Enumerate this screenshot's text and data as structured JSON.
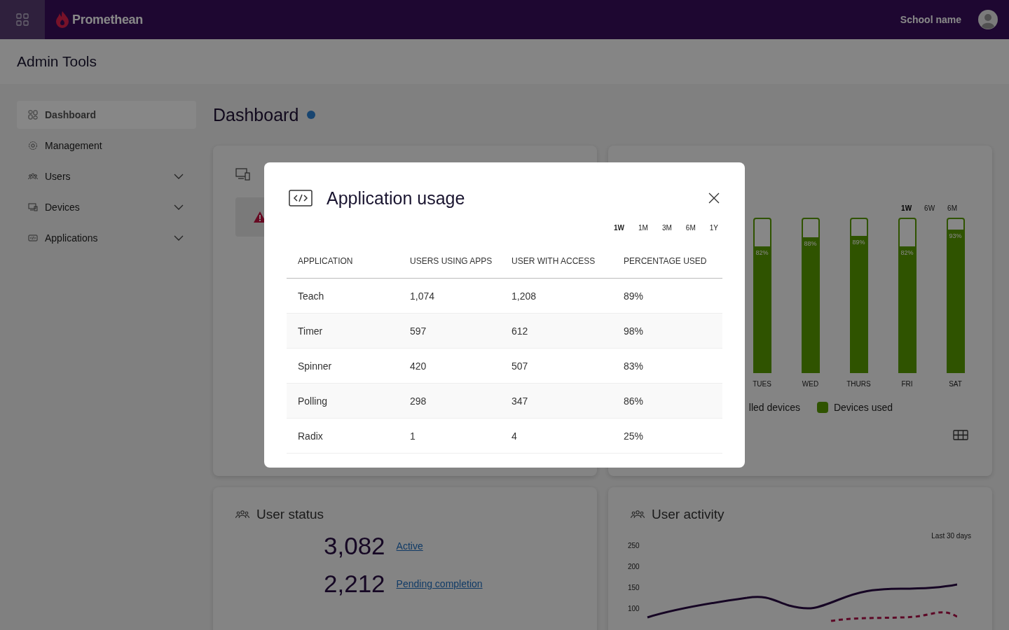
{
  "top_bar": {
    "brand": "Promethean",
    "school_name": "School name"
  },
  "header": {
    "title": "Admin Tools"
  },
  "sidebar": {
    "items": [
      {
        "label": "Dashboard",
        "selected": true
      },
      {
        "label": "Management",
        "selected": false
      },
      {
        "label": "Users",
        "selected": false,
        "expanded": false
      },
      {
        "label": "Devices",
        "selected": false,
        "expanded": false
      },
      {
        "label": "Applications",
        "selected": false,
        "expanded": false
      }
    ]
  },
  "page": {
    "title": "Dashboard"
  },
  "device_usage_card": {
    "tabs": [
      {
        "label": "1W",
        "selected": true
      },
      {
        "label": "6W",
        "selected": false
      },
      {
        "label": "6M",
        "selected": false
      }
    ],
    "bars": [
      {
        "day": "TUES",
        "label": "82%",
        "level": 0.82
      },
      {
        "day": "WED",
        "label": "88%",
        "level": 0.88
      },
      {
        "day": "THURS",
        "label": "89%",
        "level": 0.89
      },
      {
        "day": "FRI",
        "label": "82%",
        "level": 0.82
      },
      {
        "day": "SAT",
        "label": "93%",
        "level": 0.93
      }
    ],
    "legend": [
      {
        "label": "lled devices",
        "swatch": false
      },
      {
        "label": "Devices used",
        "swatch": true
      }
    ]
  },
  "user_status_card": {
    "title": "User status",
    "stats": [
      {
        "value": "3,082",
        "link": "Active"
      },
      {
        "value": "2,212",
        "link": "Pending completion"
      }
    ]
  },
  "user_activity_card": {
    "title": "User activity",
    "period": "Last 30 days",
    "y_axis_labels": [
      "250",
      "200",
      "150",
      "100"
    ]
  },
  "modal": {
    "title": "Application usage",
    "tabs": [
      {
        "label": "1W",
        "selected": true
      },
      {
        "label": "1M",
        "selected": false
      },
      {
        "label": "3M",
        "selected": false
      },
      {
        "label": "6M",
        "selected": false
      },
      {
        "label": "1Y",
        "selected": false
      }
    ],
    "table": {
      "columns": [
        "APPLICATION",
        "USERS USING APPS",
        "USER WITH ACCESS",
        "PERCENTAGE USED"
      ],
      "rows": [
        [
          "Teach",
          "1,074",
          "1,208",
          "89%"
        ],
        [
          "Timer",
          "597",
          "612",
          "98%"
        ],
        [
          "Spinner",
          "420",
          "507",
          "83%"
        ],
        [
          "Polling",
          "298",
          "347",
          "86%"
        ],
        [
          "Radix",
          "1",
          "4",
          "25%"
        ]
      ]
    }
  }
}
